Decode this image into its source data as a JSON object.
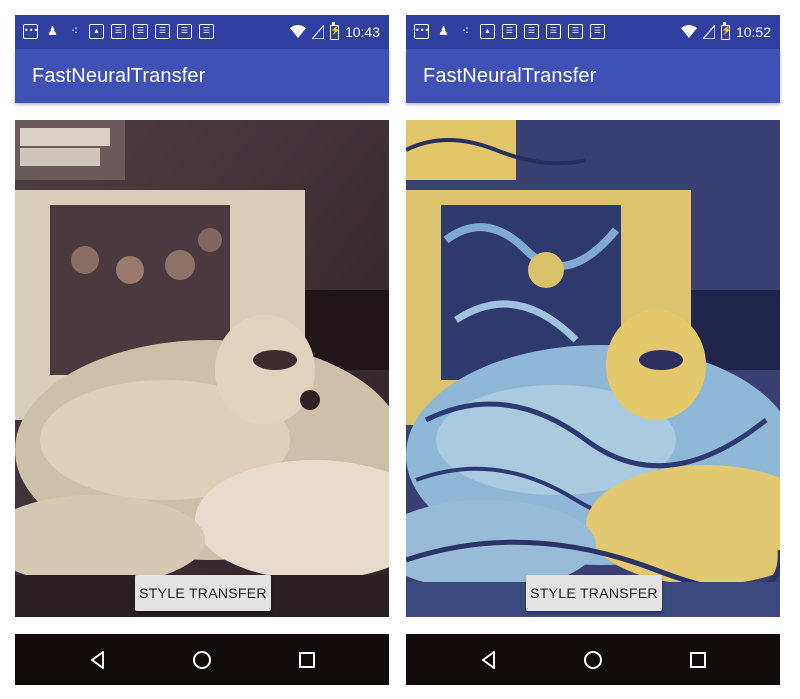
{
  "screens": [
    {
      "status_bar": {
        "time": "10:43"
      },
      "app_bar": {
        "title": "FastNeuralTransfer"
      },
      "image": {
        "description_icon": "dog-photo",
        "style": "original"
      },
      "action_button": {
        "label": "STYLE TRANSFER"
      },
      "nav_bar": {
        "back_icon": "back-icon",
        "home_icon": "home-icon",
        "recents_icon": "recents-icon"
      }
    },
    {
      "status_bar": {
        "time": "10:52"
      },
      "app_bar": {
        "title": "FastNeuralTransfer"
      },
      "image": {
        "description_icon": "dog-photo-stylized",
        "style": "stylized"
      },
      "action_button": {
        "label": "STYLE TRANSFER"
      },
      "nav_bar": {
        "back_icon": "back-icon",
        "home_icon": "home-icon",
        "recents_icon": "recents-icon"
      }
    }
  ],
  "colors": {
    "status_bar": "#2e3fa0",
    "app_bar": "#3f51b5",
    "nav_bar": "#120c0d",
    "button": "#e3e3e3"
  }
}
